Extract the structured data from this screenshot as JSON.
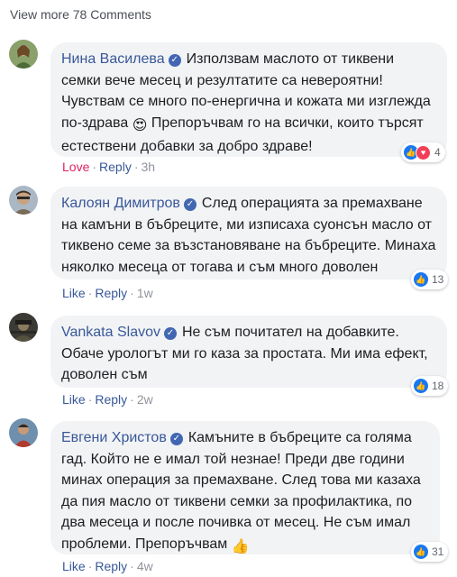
{
  "thread": {
    "view_more": "View more 78 Comments"
  },
  "comments": [
    {
      "author": "Нина Василева",
      "text": "Използвам маслото от тиквени семки вече месец и резултатите са невероятни! Чувствам се много по-енергична и кожата ми изглежда по-здрава",
      "text_after": "Препоръчвам го на всички, които търсят естествени добавки за добро здраве!",
      "emoji": "😍",
      "action_reaction": "Love",
      "reply": "Reply",
      "time": "3h",
      "reaction_count": "4",
      "reaction_icons": [
        "like-icon",
        "love-icon"
      ]
    },
    {
      "author": "Калоян Димитров",
      "text": "След операцията за премахване на камъни в бъбреците, ми изписаха суонсън масло от тиквено семе за възстановяване на бъбреците. Минаха няколко месеца от тогава и съм много доволен",
      "action_reaction": "Like",
      "reply": "Reply",
      "time": "1w",
      "reaction_count": "13",
      "reaction_icons": [
        "like-icon"
      ]
    },
    {
      "author": "Vankata Slavov",
      "text": "Не съм почитател на добавките. Обаче урологът ми го каза за простата. Ми има ефект, доволен съм",
      "action_reaction": "Like",
      "reply": "Reply",
      "time": "2w",
      "reaction_count": "18",
      "reaction_icons": [
        "like-icon"
      ]
    },
    {
      "author": "Евгени Христов",
      "text": "Камъните в бъбреците са голяма гад. Който не е имал той незнае! Преди две години минах операция за премахване. След това ми казаха да пия масло от тиквени семки за профилактика, по два месеца и после почивка от месец. Не съм имал проблеми. Препоръчвам",
      "emoji": "👍",
      "action_reaction": "Like",
      "reply": "Reply",
      "time": "4w",
      "reaction_count": "31",
      "reaction_icons": [
        "like-icon"
      ]
    }
  ],
  "colors": {
    "author": "#385898",
    "bubble": "#f2f3f5",
    "like": "#1877f2",
    "love": "#f33e58",
    "meta": "#90949c"
  }
}
